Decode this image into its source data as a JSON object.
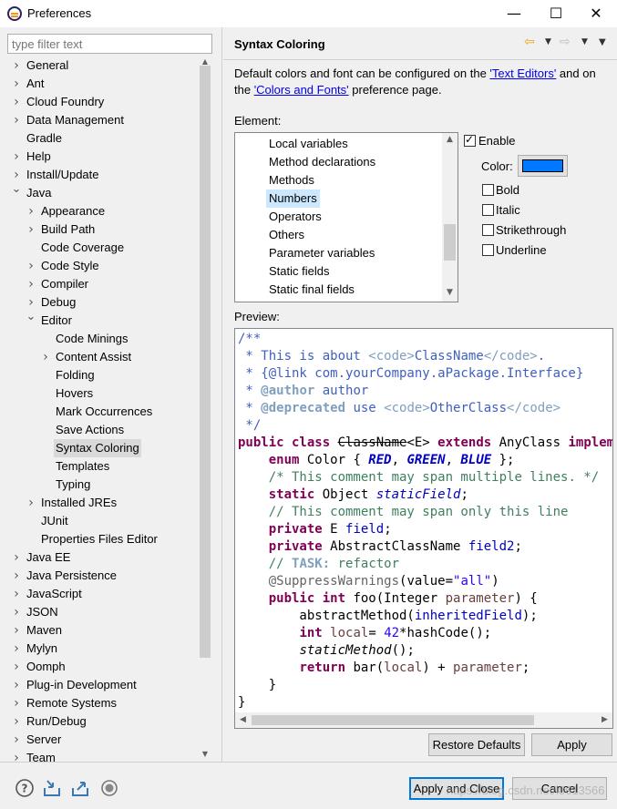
{
  "window": {
    "title": "Preferences",
    "minimize_glyph": "—",
    "maximize_glyph": "☐",
    "close_glyph": "✕"
  },
  "filter": {
    "placeholder": "type filter text",
    "value": ""
  },
  "tree": [
    {
      "label": "General",
      "level": 0,
      "twisty": "collapsed"
    },
    {
      "label": "Ant",
      "level": 0,
      "twisty": "collapsed"
    },
    {
      "label": "Cloud Foundry",
      "level": 0,
      "twisty": "collapsed"
    },
    {
      "label": "Data Management",
      "level": 0,
      "twisty": "collapsed"
    },
    {
      "label": "Gradle",
      "level": 0,
      "twisty": "none"
    },
    {
      "label": "Help",
      "level": 0,
      "twisty": "collapsed"
    },
    {
      "label": "Install/Update",
      "level": 0,
      "twisty": "collapsed"
    },
    {
      "label": "Java",
      "level": 0,
      "twisty": "expanded"
    },
    {
      "label": "Appearance",
      "level": 1,
      "twisty": "collapsed"
    },
    {
      "label": "Build Path",
      "level": 1,
      "twisty": "collapsed"
    },
    {
      "label": "Code Coverage",
      "level": 1,
      "twisty": "none"
    },
    {
      "label": "Code Style",
      "level": 1,
      "twisty": "collapsed"
    },
    {
      "label": "Compiler",
      "level": 1,
      "twisty": "collapsed"
    },
    {
      "label": "Debug",
      "level": 1,
      "twisty": "collapsed"
    },
    {
      "label": "Editor",
      "level": 1,
      "twisty": "expanded"
    },
    {
      "label": "Code Minings",
      "level": 2,
      "twisty": "none"
    },
    {
      "label": "Content Assist",
      "level": 2,
      "twisty": "collapsed"
    },
    {
      "label": "Folding",
      "level": 2,
      "twisty": "none"
    },
    {
      "label": "Hovers",
      "level": 2,
      "twisty": "none"
    },
    {
      "label": "Mark Occurrences",
      "level": 2,
      "twisty": "none"
    },
    {
      "label": "Save Actions",
      "level": 2,
      "twisty": "none"
    },
    {
      "label": "Syntax Coloring",
      "level": 2,
      "twisty": "none",
      "selected": true
    },
    {
      "label": "Templates",
      "level": 2,
      "twisty": "none"
    },
    {
      "label": "Typing",
      "level": 2,
      "twisty": "none"
    },
    {
      "label": "Installed JREs",
      "level": 1,
      "twisty": "collapsed"
    },
    {
      "label": "JUnit",
      "level": 1,
      "twisty": "none"
    },
    {
      "label": "Properties Files Editor",
      "level": 1,
      "twisty": "none"
    },
    {
      "label": "Java EE",
      "level": 0,
      "twisty": "collapsed"
    },
    {
      "label": "Java Persistence",
      "level": 0,
      "twisty": "collapsed"
    },
    {
      "label": "JavaScript",
      "level": 0,
      "twisty": "collapsed"
    },
    {
      "label": "JSON",
      "level": 0,
      "twisty": "collapsed"
    },
    {
      "label": "Maven",
      "level": 0,
      "twisty": "collapsed"
    },
    {
      "label": "Mylyn",
      "level": 0,
      "twisty": "collapsed"
    },
    {
      "label": "Oomph",
      "level": 0,
      "twisty": "collapsed"
    },
    {
      "label": "Plug-in Development",
      "level": 0,
      "twisty": "collapsed"
    },
    {
      "label": "Remote Systems",
      "level": 0,
      "twisty": "collapsed"
    },
    {
      "label": "Run/Debug",
      "level": 0,
      "twisty": "collapsed"
    },
    {
      "label": "Server",
      "level": 0,
      "twisty": "collapsed"
    },
    {
      "label": "Team",
      "level": 0,
      "twisty": "collapsed"
    }
  ],
  "page": {
    "title": "Syntax Coloring",
    "desc_before": "Default colors and font can be configured on the ",
    "link1": "'Text Editors'",
    "desc_mid": " and on the ",
    "link2": "'Colors and Fonts'",
    "desc_after": " preference page.",
    "element_label": "Element:",
    "preview_label": "Preview:"
  },
  "elements": [
    {
      "label": "Local variables"
    },
    {
      "label": "Method declarations"
    },
    {
      "label": "Methods"
    },
    {
      "label": "Numbers",
      "selected": true
    },
    {
      "label": "Operators"
    },
    {
      "label": "Others"
    },
    {
      "label": "Parameter variables"
    },
    {
      "label": "Static fields"
    },
    {
      "label": "Static final fields"
    }
  ],
  "options": {
    "enable_label": "Enable",
    "enable_checked": true,
    "color_label": "Color:",
    "color_value": "#0078ff",
    "bold_label": "Bold",
    "bold_checked": false,
    "italic_label": "Italic",
    "italic_checked": false,
    "strike_label": "Strikethrough",
    "strike_checked": false,
    "underline_label": "Underline",
    "underline_checked": false
  },
  "buttons": {
    "restore_defaults": "Restore Defaults",
    "apply": "Apply",
    "apply_and_close": "Apply and Close",
    "cancel": "Cancel"
  },
  "bottom_icons": [
    "help-icon",
    "import-icon",
    "export-icon",
    "record-icon"
  ],
  "watermark": "https://blog.csdn.net/l8613566",
  "code_lines": [
    [
      [
        "/**",
        "jd"
      ]
    ],
    [
      [
        " * This is about ",
        "jd"
      ],
      [
        "<code>",
        "jdtag"
      ],
      [
        "ClassName",
        "jd"
      ],
      [
        "</code>",
        "jdtag"
      ],
      [
        ".",
        "jd"
      ]
    ],
    [
      [
        " * {@link com.yourCompany.aPackage.Interface}",
        "jd"
      ]
    ],
    [
      [
        " * ",
        "jd"
      ],
      [
        "@author",
        "jdkw"
      ],
      [
        " author",
        "jd"
      ]
    ],
    [
      [
        " * ",
        "jd"
      ],
      [
        "@deprecated",
        "jdkw"
      ],
      [
        " use ",
        "jd"
      ],
      [
        "<code>",
        "jdtag"
      ],
      [
        "OtherClass",
        "jd"
      ],
      [
        "</code>",
        "jdtag"
      ]
    ],
    [
      [
        " */",
        "jd"
      ]
    ],
    [
      [
        "public class",
        "kw"
      ],
      [
        " ",
        ""
      ],
      [
        "ClassName",
        "strike"
      ],
      [
        "<E> ",
        ""
      ],
      [
        "extends",
        "kw"
      ],
      [
        " AnyClass ",
        ""
      ],
      [
        "implements",
        "kw"
      ]
    ],
    [
      [
        "    ",
        ""
      ],
      [
        "enum",
        "kw"
      ],
      [
        " Color { ",
        ""
      ],
      [
        "RED",
        "enum"
      ],
      [
        ", ",
        ""
      ],
      [
        "GREEN",
        "enum"
      ],
      [
        ", ",
        ""
      ],
      [
        "BLUE",
        "enum"
      ],
      [
        " };",
        ""
      ]
    ],
    [
      [
        "    ",
        ""
      ],
      [
        "/* This comment may span multiple lines. */",
        "cm"
      ]
    ],
    [
      [
        "    ",
        ""
      ],
      [
        "static",
        "kw"
      ],
      [
        " Object ",
        ""
      ],
      [
        "staticField",
        "sfield"
      ],
      [
        ";",
        ""
      ]
    ],
    [
      [
        "    ",
        ""
      ],
      [
        "// This comment may span only this line",
        "cm"
      ]
    ],
    [
      [
        "    ",
        ""
      ],
      [
        "private",
        "kw"
      ],
      [
        " E ",
        ""
      ],
      [
        "field",
        "field"
      ],
      [
        ";",
        ""
      ]
    ],
    [
      [
        "    ",
        ""
      ],
      [
        "private",
        "kw"
      ],
      [
        " AbstractClassName ",
        ""
      ],
      [
        "field2",
        "field"
      ],
      [
        ";",
        ""
      ]
    ],
    [
      [
        "    ",
        ""
      ],
      [
        "// ",
        "cm"
      ],
      [
        "TASK:",
        "task"
      ],
      [
        " refactor",
        "cm"
      ]
    ],
    [
      [
        "    ",
        ""
      ],
      [
        "@SuppressWarnings",
        "ann"
      ],
      [
        "(value=",
        ""
      ],
      [
        "\"all\"",
        "str"
      ],
      [
        ")",
        ""
      ]
    ],
    [
      [
        "    ",
        ""
      ],
      [
        "public int",
        "kw"
      ],
      [
        " foo(Integer ",
        ""
      ],
      [
        "parameter",
        "param"
      ],
      [
        ") {",
        ""
      ]
    ],
    [
      [
        "        abstractMethod(",
        ""
      ],
      [
        "inheritedField",
        "field"
      ],
      [
        ");",
        ""
      ]
    ],
    [
      [
        "        ",
        ""
      ],
      [
        "int",
        "kw"
      ],
      [
        " ",
        ""
      ],
      [
        "local",
        "local"
      ],
      [
        "= ",
        ""
      ],
      [
        "42",
        "num"
      ],
      [
        "*hashCode();",
        ""
      ]
    ],
    [
      [
        "        ",
        ""
      ],
      [
        "staticMethod",
        "ital"
      ],
      [
        "();",
        ""
      ]
    ],
    [
      [
        "        ",
        ""
      ],
      [
        "return",
        "kw"
      ],
      [
        " bar(",
        ""
      ],
      [
        "local",
        "local"
      ],
      [
        ") + ",
        ""
      ],
      [
        "parameter",
        "param"
      ],
      [
        ";",
        ""
      ]
    ],
    [
      [
        "    }",
        ""
      ]
    ],
    [
      [
        "}",
        ""
      ]
    ]
  ]
}
